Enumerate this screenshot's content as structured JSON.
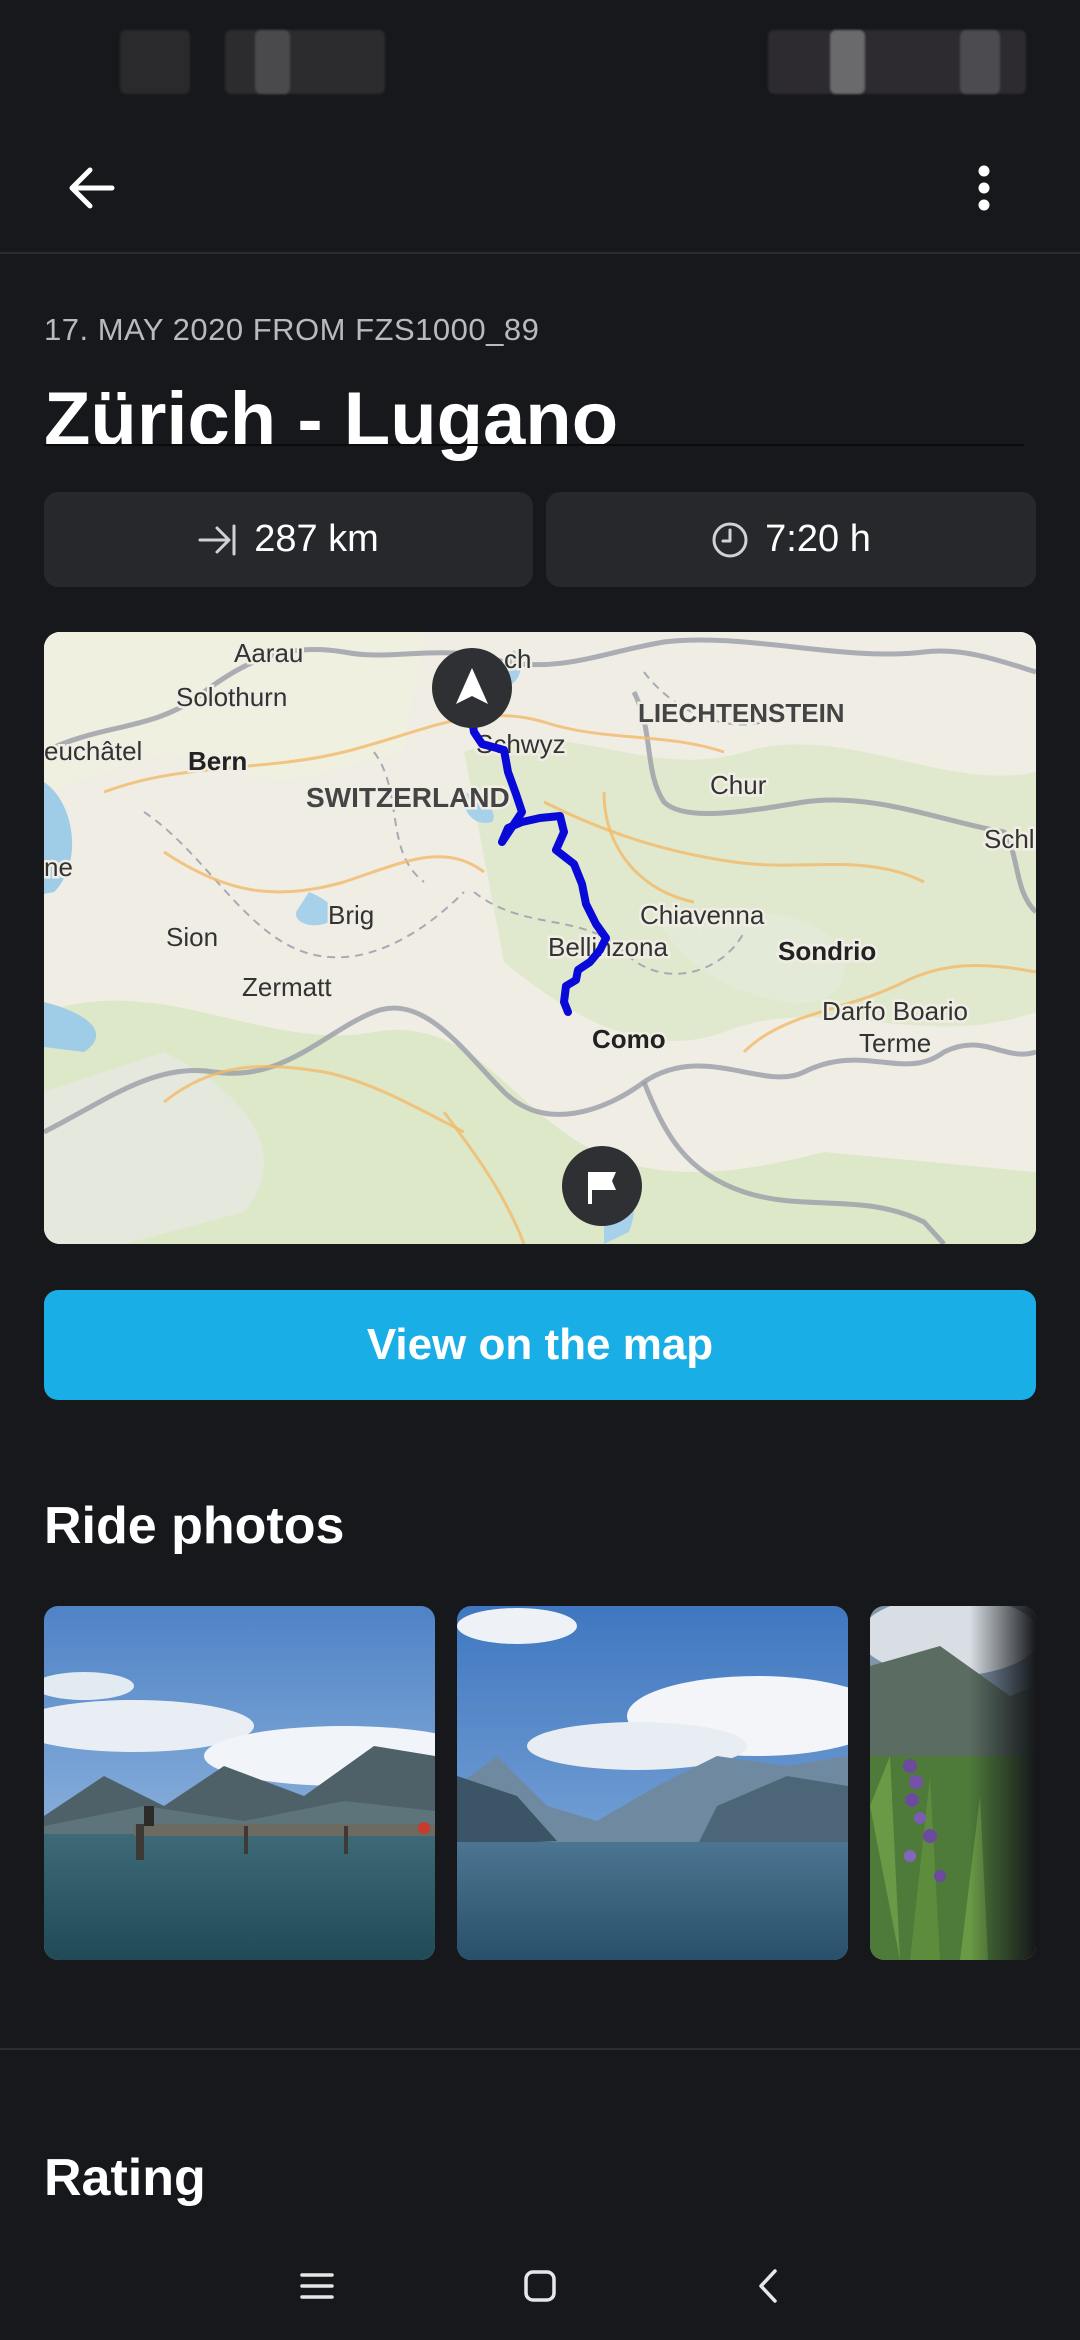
{
  "appbar": {
    "back_icon": "arrow-left-icon",
    "more_icon": "more-vertical-icon"
  },
  "ride": {
    "meta": "17. MAY 2020 FROM FZS1000_89",
    "title": "Zürich - Lugano",
    "distance": "287 km",
    "distance_icon": "arrow-to-right-icon",
    "duration": "7:20 h",
    "duration_icon": "clock-icon"
  },
  "map": {
    "labels": {
      "aarau": "Aarau",
      "zurich": "ch",
      "solothurn": "Solothurn",
      "liechtenstein": "LIECHTENSTEIN",
      "neuchatel": "euchâtel",
      "bern": "Bern",
      "schwyz": "Schwyz",
      "switzerland": "SWITZERLAND",
      "chur": "Chur",
      "schl": "Schl",
      "ne": "ne",
      "brig": "Brig",
      "chiavenna": "Chiavenna",
      "sion": "Sion",
      "bellinzona": "Bellinzona",
      "sondrio": "Sondrio",
      "zermatt": "Zermatt",
      "darfo_1": "Darfo Boario",
      "darfo_2": "Terme",
      "como": "Como"
    },
    "route_color": "#0a0ad8",
    "start_icon": "navigation-arrow-icon",
    "finish_icon": "flag-icon"
  },
  "actions": {
    "view_on_map": "View on the map"
  },
  "sections": {
    "ride_photos": "Ride photos",
    "rating": "Rating"
  },
  "colors": {
    "accent": "#1aaee6",
    "background": "#16181b",
    "card": "#26282c"
  },
  "navbar": {
    "menu_icon": "menu-lines-icon",
    "home_icon": "square-home-icon",
    "back_icon": "chevron-left-icon"
  }
}
